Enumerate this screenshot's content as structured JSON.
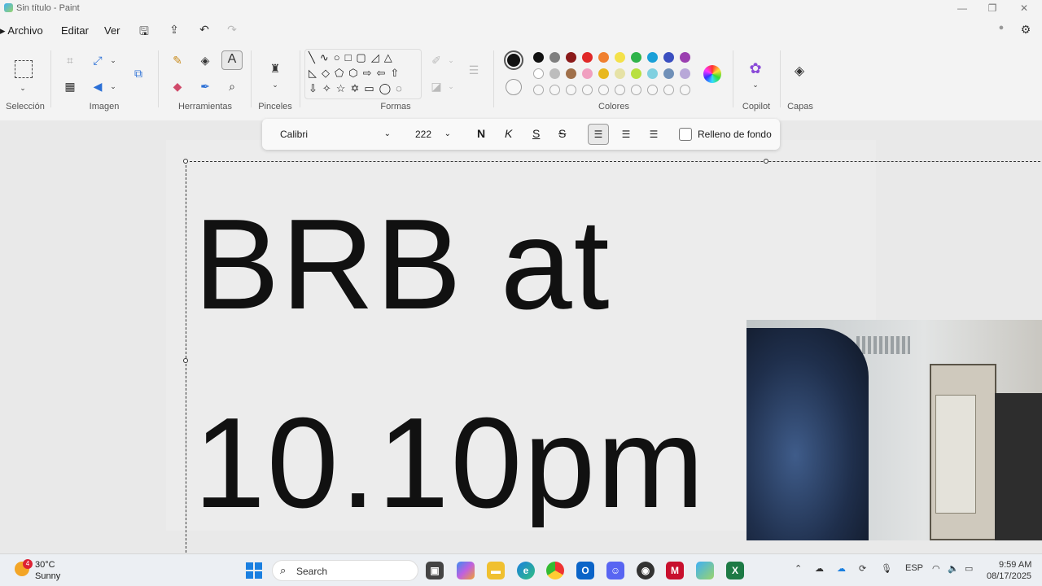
{
  "window": {
    "title": "Sin título - Paint"
  },
  "menu": {
    "archivo": "Archivo",
    "editar": "Editar",
    "ver": "Ver"
  },
  "ribbon": {
    "groups": {
      "seleccion": "Selección",
      "imagen": "Imagen",
      "herramientas": "Herramientas",
      "pinceles": "Pinceles",
      "formas": "Formas",
      "colores": "Colores",
      "copilot": "Copilot",
      "capas": "Capas"
    },
    "colors_row1": [
      "#111111",
      "#7f7f7f",
      "#8b1a1a",
      "#e02828",
      "#f08030",
      "#f4e14a",
      "#2fb34a",
      "#1aa0d8",
      "#3a4fc0",
      "#9b3fb0"
    ],
    "colors_row2": [
      "#ffffff",
      "#bdbdbd",
      "#a0704a",
      "#f0a0c0",
      "#e8b820",
      "#e6e2a6",
      "#b8e040",
      "#80d0e0",
      "#7090b8",
      "#b8a8d8"
    ],
    "current_color": "#111111"
  },
  "textbar": {
    "font": "Calibri",
    "size": "222",
    "bold": "N",
    "italic": "K",
    "underline": "S",
    "strike": "S",
    "background_fill_label": "Relleno de fondo"
  },
  "canvas": {
    "line1": "BRB at",
    "line2": "10.10pm"
  },
  "taskbar": {
    "weather_temp": "30°C",
    "weather_desc": "Sunny",
    "weather_badge": "4",
    "search_placeholder": "Search",
    "language": "ESP",
    "time": "9:59 AM",
    "date": "08/17/2025"
  }
}
